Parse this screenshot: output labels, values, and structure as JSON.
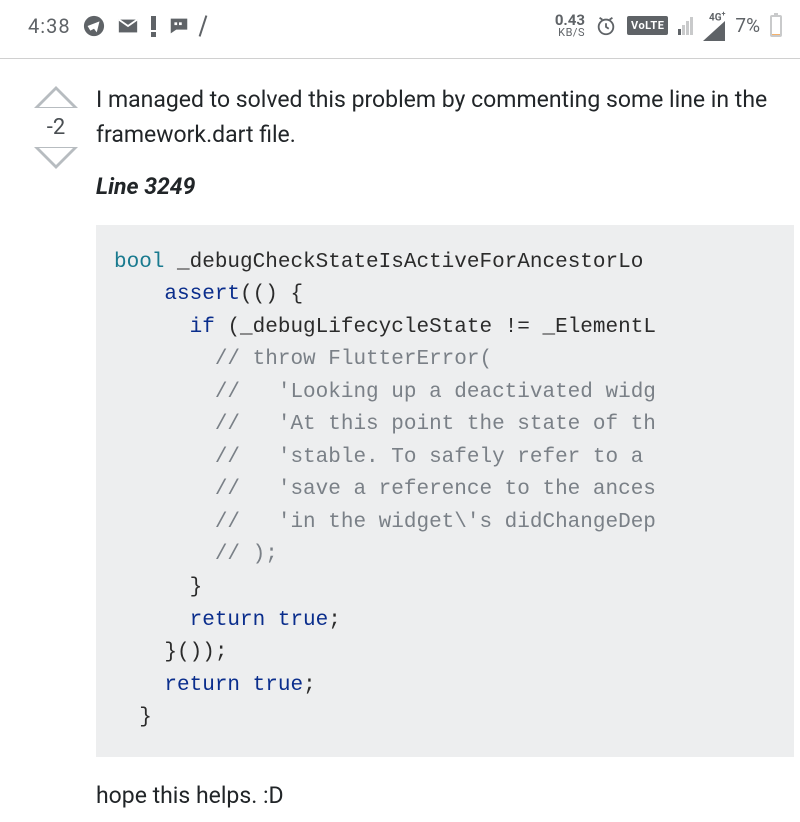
{
  "status": {
    "time": "4:38",
    "net": {
      "rate": "0.43",
      "unit": "KB/S"
    },
    "volte": "V°LTE",
    "net_gen": "4G",
    "net_gen_sup": "+",
    "battery_pct": "7%",
    "battery_level_pct": 7
  },
  "vote": {
    "score": "-2"
  },
  "answer": {
    "intro": "I managed to solved this problem by commenting some line in the framework.dart file.",
    "line_label": "Line 3249",
    "closing": "hope this helps. :D",
    "code": {
      "t_bool": "bool",
      "t_fn": " _debugCheckStateIsActiveForAncestorLo",
      "t_assert": "assert",
      "t_assert_tail": "(() {",
      "t_if": "if",
      "t_if_expr": " (_debugLifecycleState != _ElementL",
      "c1": "// throw FlutterError(",
      "c2": "//   'Looking up a deactivated widg",
      "c3": "//   'At this point the state of th",
      "c4": "//   'stable. To safely refer to a ",
      "c5": "//   'save a reference to the ances",
      "c6": "//   'in the widget\\'s didChangeDep",
      "c7": "// );",
      "t_cb": "}",
      "t_return": "return",
      "t_true": " true",
      "t_semi": ";",
      "t_assert_close": "}());",
      "t_fn_close": "}"
    }
  }
}
